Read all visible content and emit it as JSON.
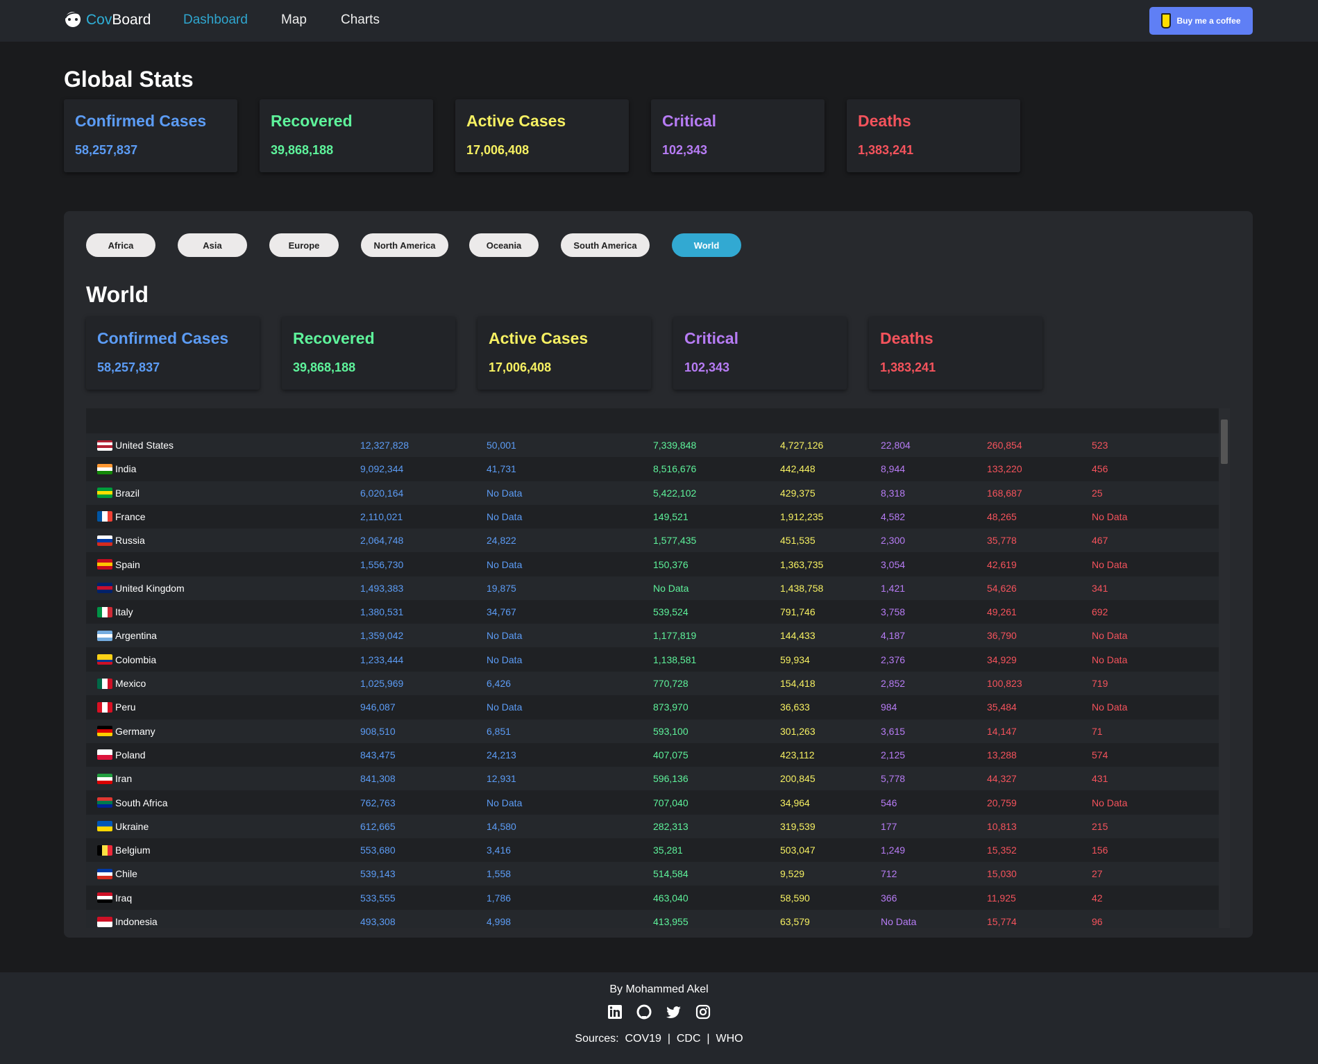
{
  "nav": {
    "brand_a": "Cov",
    "brand_b": "Board",
    "links": [
      "Dashboard",
      "Map",
      "Charts"
    ],
    "coffee": "Buy me a coffee"
  },
  "global": {
    "title": "Global Stats",
    "cards": [
      {
        "label": "Confirmed Cases",
        "value": "58,257,837",
        "color": "#5c9cf5"
      },
      {
        "label": "Recovered",
        "value": "39,868,188",
        "color": "#5ef39b"
      },
      {
        "label": "Active Cases",
        "value": "17,006,408",
        "color": "#f6f062"
      },
      {
        "label": "Critical",
        "value": "102,343",
        "color": "#b77cf5"
      },
      {
        "label": "Deaths",
        "value": "1,383,241",
        "color": "#f5535c"
      }
    ]
  },
  "regions": [
    "Africa",
    "Asia",
    "Europe",
    "North America",
    "Oceania",
    "South America",
    "World"
  ],
  "selected_region": "World",
  "world": {
    "title": "World",
    "cards": [
      {
        "label": "Confirmed Cases",
        "value": "58,257,837",
        "color": "#5c9cf5"
      },
      {
        "label": "Recovered",
        "value": "39,868,188",
        "color": "#5ef39b"
      },
      {
        "label": "Active Cases",
        "value": "17,006,408",
        "color": "#f6f062"
      },
      {
        "label": "Critical",
        "value": "102,343",
        "color": "#b77cf5"
      },
      {
        "label": "Deaths",
        "value": "1,383,241",
        "color": "#f5535c"
      }
    ]
  },
  "column_colors": [
    "#5c9cf5",
    "#5c9cf5",
    "#5ef39b",
    "#f6f062",
    "#b77cf5",
    "#f5535c",
    "#f5535c"
  ],
  "rows": [
    {
      "country": "United States",
      "flag": [
        "#b22234",
        "#fff",
        "#b22234",
        "#fff"
      ],
      "v": [
        "12,327,828",
        "50,001",
        "7,339,848",
        "4,727,126",
        "22,804",
        "260,854",
        "523"
      ]
    },
    {
      "country": "India",
      "flag": [
        "#ff9933",
        "#fff",
        "#138808"
      ],
      "v": [
        "9,092,344",
        "41,731",
        "8,516,676",
        "442,448",
        "8,944",
        "133,220",
        "456"
      ]
    },
    {
      "country": "Brazil",
      "flag": [
        "#009c3b",
        "#ffdf00",
        "#009c3b"
      ],
      "v": [
        "6,020,164",
        "No Data",
        "5,422,102",
        "429,375",
        "8,318",
        "168,687",
        "25"
      ]
    },
    {
      "country": "France",
      "flag": [
        "#0055a4",
        "#fff",
        "#ef4135"
      ],
      "h": true,
      "v": [
        "2,110,021",
        "No Data",
        "149,521",
        "1,912,235",
        "4,582",
        "48,265",
        "No Data"
      ]
    },
    {
      "country": "Russia",
      "flag": [
        "#fff",
        "#0039a6",
        "#d52b1e"
      ],
      "v": [
        "2,064,748",
        "24,822",
        "1,577,435",
        "451,535",
        "2,300",
        "35,778",
        "467"
      ]
    },
    {
      "country": "Spain",
      "flag": [
        "#c60b1e",
        "#ffc400",
        "#c60b1e"
      ],
      "v": [
        "1,556,730",
        "No Data",
        "150,376",
        "1,363,735",
        "3,054",
        "42,619",
        "No Data"
      ]
    },
    {
      "country": "United Kingdom",
      "flag": [
        "#012169",
        "#c8102e",
        "#012169"
      ],
      "v": [
        "1,493,383",
        "19,875",
        "No Data",
        "1,438,758",
        "1,421",
        "54,626",
        "341"
      ]
    },
    {
      "country": "Italy",
      "flag": [
        "#009246",
        "#fff",
        "#ce2b37"
      ],
      "h": true,
      "v": [
        "1,380,531",
        "34,767",
        "539,524",
        "791,746",
        "3,758",
        "49,261",
        "692"
      ]
    },
    {
      "country": "Argentina",
      "flag": [
        "#74acdf",
        "#fff",
        "#74acdf"
      ],
      "v": [
        "1,359,042",
        "No Data",
        "1,177,819",
        "144,433",
        "4,187",
        "36,790",
        "No Data"
      ]
    },
    {
      "country": "Colombia",
      "flag": [
        "#fcd116",
        "#fcd116",
        "#003893",
        "#ce1126"
      ],
      "v": [
        "1,233,444",
        "No Data",
        "1,138,581",
        "59,934",
        "2,376",
        "34,929",
        "No Data"
      ]
    },
    {
      "country": "Mexico",
      "flag": [
        "#006847",
        "#fff",
        "#ce1126"
      ],
      "h": true,
      "v": [
        "1,025,969",
        "6,426",
        "770,728",
        "154,418",
        "2,852",
        "100,823",
        "719"
      ]
    },
    {
      "country": "Peru",
      "flag": [
        "#d91023",
        "#fff",
        "#d91023"
      ],
      "h": true,
      "v": [
        "946,087",
        "No Data",
        "873,970",
        "36,633",
        "984",
        "35,484",
        "No Data"
      ]
    },
    {
      "country": "Germany",
      "flag": [
        "#000",
        "#dd0000",
        "#ffce00"
      ],
      "v": [
        "908,510",
        "6,851",
        "593,100",
        "301,263",
        "3,615",
        "14,147",
        "71"
      ]
    },
    {
      "country": "Poland",
      "flag": [
        "#fff",
        "#dc143c"
      ],
      "v": [
        "843,475",
        "24,213",
        "407,075",
        "423,112",
        "2,125",
        "13,288",
        "574"
      ]
    },
    {
      "country": "Iran",
      "flag": [
        "#239f40",
        "#fff",
        "#da0000"
      ],
      "v": [
        "841,308",
        "12,931",
        "596,136",
        "200,845",
        "5,778",
        "44,327",
        "431"
      ]
    },
    {
      "country": "South Africa",
      "flag": [
        "#de3831",
        "#007a4d",
        "#002395"
      ],
      "v": [
        "762,763",
        "No Data",
        "707,040",
        "34,964",
        "546",
        "20,759",
        "No Data"
      ]
    },
    {
      "country": "Ukraine",
      "flag": [
        "#0057b7",
        "#ffd700"
      ],
      "v": [
        "612,665",
        "14,580",
        "282,313",
        "319,539",
        "177",
        "10,813",
        "215"
      ]
    },
    {
      "country": "Belgium",
      "flag": [
        "#000",
        "#fae042",
        "#ed2939"
      ],
      "h": true,
      "v": [
        "553,680",
        "3,416",
        "35,281",
        "503,047",
        "1,249",
        "15,352",
        "156"
      ]
    },
    {
      "country": "Chile",
      "flag": [
        "#0039a6",
        "#fff",
        "#d52b1e"
      ],
      "v": [
        "539,143",
        "1,558",
        "514,584",
        "9,529",
        "712",
        "15,030",
        "27"
      ]
    },
    {
      "country": "Iraq",
      "flag": [
        "#ce1126",
        "#fff",
        "#000"
      ],
      "v": [
        "533,555",
        "1,786",
        "463,040",
        "58,590",
        "366",
        "11,925",
        "42"
      ]
    },
    {
      "country": "Indonesia",
      "flag": [
        "#ce1126",
        "#fff"
      ],
      "v": [
        "493,308",
        "4,998",
        "413,955",
        "63,579",
        "No Data",
        "15,774",
        "96"
      ]
    }
  ],
  "footer": {
    "by": "By Mohammed Akel",
    "sources_label": "Sources:",
    "sources": [
      "COV19",
      "CDC",
      "WHO"
    ]
  }
}
